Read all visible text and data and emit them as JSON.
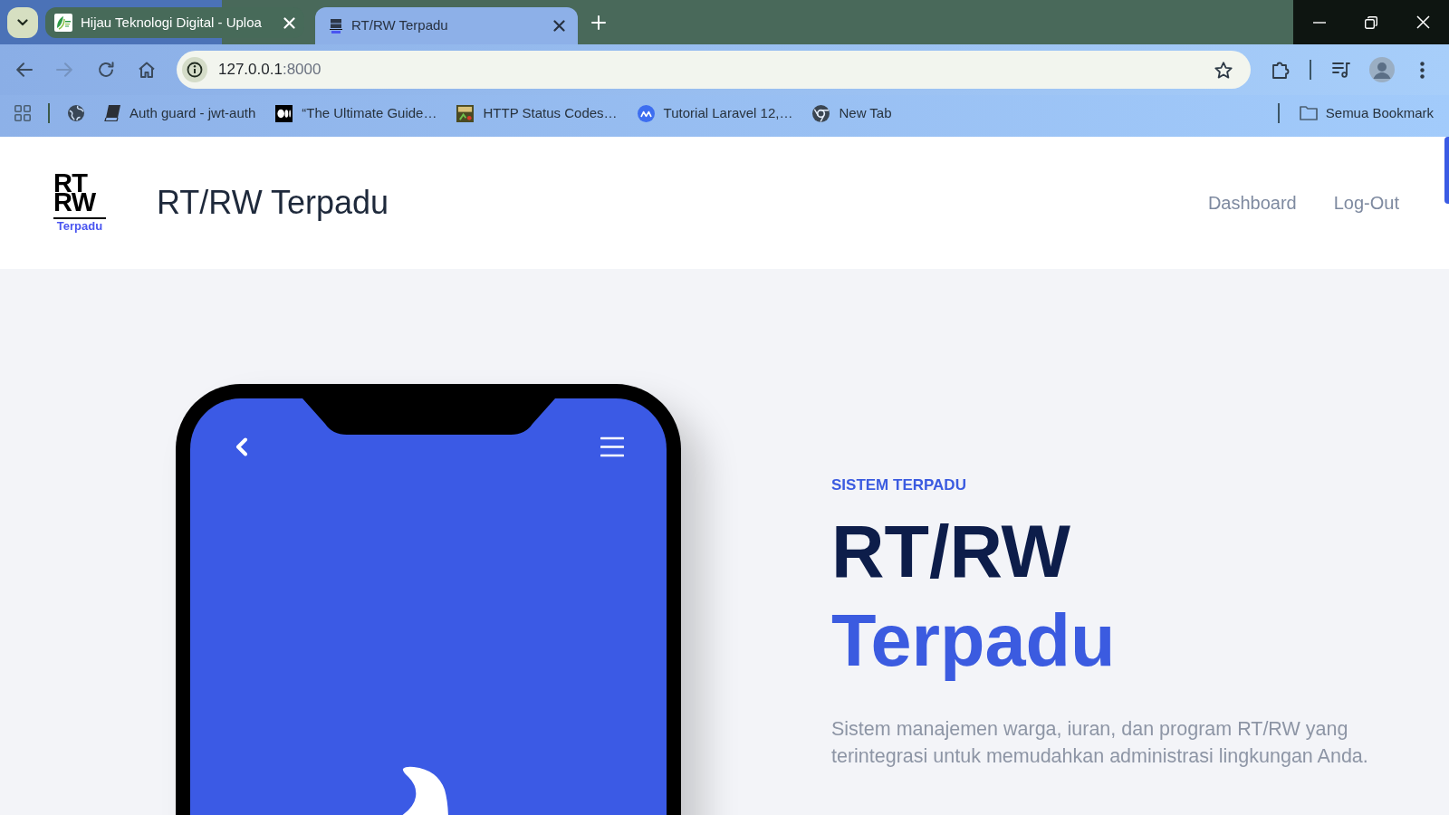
{
  "browser": {
    "tabs": [
      {
        "kind": "leaf",
        "title": "Hijau Teknologi Digital - Uploa",
        "selected": false
      },
      {
        "kind": "logo",
        "title": "RT/RW Terpadu",
        "selected": true
      }
    ],
    "toolbar": {
      "forward_disabled": true,
      "url": {
        "host": "127.0.0.1",
        "port": ":8000"
      }
    },
    "bookmarks": [
      {
        "kind": "globe"
      },
      {
        "kind": "book",
        "label": "Auth guard - jwt-auth"
      },
      {
        "kind": "tile",
        "label": "“The Ultimate Guide…"
      },
      {
        "kind": "api",
        "label": "HTTP Status Codes…"
      },
      {
        "kind": "wave",
        "label": "Tutorial Laravel 12,…"
      },
      {
        "kind": "ring",
        "label": "New Tab"
      }
    ],
    "all_bookmarks": "Semua Bookmark"
  },
  "page": {
    "header": {
      "logo": {
        "letters": [
          "RT",
          "RW"
        ],
        "tagline": "Terpadu"
      },
      "title": "RT/RW Terpadu",
      "nav": [
        {
          "label": "Dashboard"
        },
        {
          "label": "Log-Out"
        }
      ]
    },
    "hero": {
      "eyebrow": "SISTEM TERPADU",
      "heading": [
        "RT/RW",
        "Terpadu"
      ],
      "description": "Sistem manajemen warga, iuran, dan program RT/RW yang terintegrasi untuk memudahkan administrasi lingkungan Anda."
    }
  }
}
